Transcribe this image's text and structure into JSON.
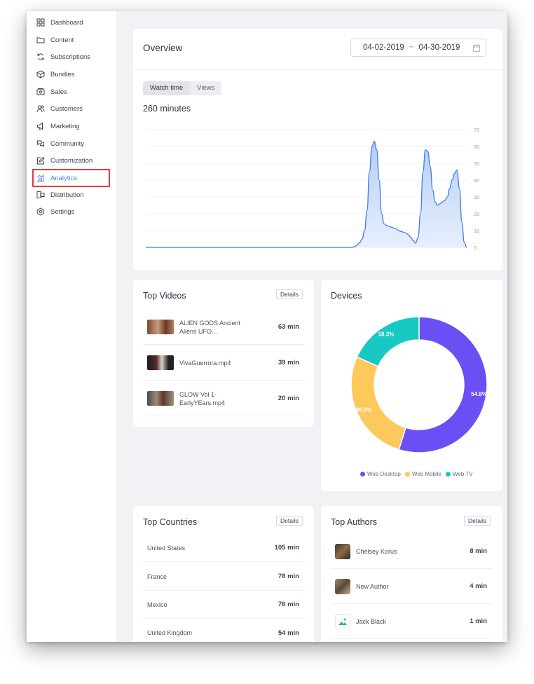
{
  "sidebar": {
    "items": [
      {
        "label": "Dashboard",
        "icon": "grid-icon"
      },
      {
        "label": "Content",
        "icon": "folder-icon"
      },
      {
        "label": "Subscriptions",
        "icon": "refresh-icon"
      },
      {
        "label": "Bundles",
        "icon": "box-icon"
      },
      {
        "label": "Sales",
        "icon": "cash-icon"
      },
      {
        "label": "Customers",
        "icon": "users-icon"
      },
      {
        "label": "Marketing",
        "icon": "megaphone-icon"
      },
      {
        "label": "Community",
        "icon": "chat-icon"
      },
      {
        "label": "Customization",
        "icon": "edit-icon"
      },
      {
        "label": "Analytics",
        "icon": "chart-icon"
      },
      {
        "label": "Distribution",
        "icon": "share-icon"
      },
      {
        "label": "Settings",
        "icon": "gear-icon"
      }
    ],
    "active": "Analytics"
  },
  "overview": {
    "title": "Overview",
    "date_from": "04-02-2019",
    "date_sep": "~",
    "date_to": "04-30-2019",
    "tabs": [
      "Watch time",
      "Views"
    ],
    "active_tab": "Watch time",
    "total": "260 minutes"
  },
  "chart_data": {
    "type": "area",
    "y_ticks": [
      "70",
      "60",
      "50",
      "40",
      "30",
      "20",
      "10",
      "0"
    ],
    "ylim": [
      0,
      70
    ],
    "values": [
      0,
      0,
      0,
      0,
      0,
      0,
      0,
      0,
      0,
      0,
      0,
      0,
      0,
      0,
      0,
      0,
      0,
      0,
      0,
      0,
      0,
      0,
      0,
      0,
      0,
      0,
      0,
      0,
      0,
      0,
      0,
      0,
      0,
      0,
      0,
      0,
      0,
      0,
      0,
      0,
      0,
      0,
      0,
      0,
      0,
      0,
      0,
      0,
      0,
      0,
      0,
      0,
      0,
      0,
      0,
      0,
      0,
      0,
      0,
      0,
      0,
      0,
      0,
      0,
      0,
      0,
      0,
      0,
      0,
      0,
      0,
      0,
      0,
      0,
      0,
      0,
      0,
      0,
      0,
      0,
      0,
      0,
      0,
      0,
      0,
      0,
      0.5,
      1.5,
      3,
      5,
      10,
      22,
      45,
      60,
      63,
      58,
      40,
      20,
      14,
      13,
      12.5,
      12,
      11.5,
      11,
      10,
      9.5,
      9,
      8.5,
      7.5,
      6,
      4,
      2.5,
      6,
      20,
      45,
      58,
      57,
      48,
      34,
      27,
      25,
      26,
      27,
      28,
      30,
      35,
      40,
      44,
      46,
      35,
      15,
      3,
      0
    ],
    "series_color": "#3d7be8"
  },
  "top_videos": {
    "title": "Top Videos",
    "details_label": "Details",
    "items": [
      {
        "name_line1": "ALIEN GODS Ancient",
        "name_line2": "Aliens UFO...",
        "value": "63 min"
      },
      {
        "name_line1": "VivaGuerrora.mp4",
        "name_line2": "",
        "value": "39 min"
      },
      {
        "name_line1": "GLOW Vol 1-",
        "name_line2": "EarlyYEars.mp4",
        "value": "20 min"
      }
    ]
  },
  "devices": {
    "title": "Devices",
    "slices": [
      {
        "name": "Web Desktop",
        "value": 54.8,
        "label": "54.8%",
        "color": "#6c4ef5"
      },
      {
        "name": "Web Mobile",
        "value": 26.9,
        "label": "26.9%",
        "color": "#fdc95b"
      },
      {
        "name": "Web TV",
        "value": 18.3,
        "label": "18.3%",
        "color": "#17c9c2"
      }
    ]
  },
  "top_countries": {
    "title": "Top Countries",
    "details_label": "Details",
    "items": [
      {
        "name": "United States",
        "value": "105 min"
      },
      {
        "name": "France",
        "value": "78 min"
      },
      {
        "name": "Mexico",
        "value": "76 min"
      },
      {
        "name": "United Kingdom",
        "value": "54 min"
      }
    ]
  },
  "top_authors": {
    "title": "Top Authors",
    "details_label": "Details",
    "items": [
      {
        "name": "Chelsey Korus",
        "value": "8 min"
      },
      {
        "name": "New Author",
        "value": "4 min"
      },
      {
        "name": "Jack Black",
        "value": "1 min"
      }
    ]
  }
}
